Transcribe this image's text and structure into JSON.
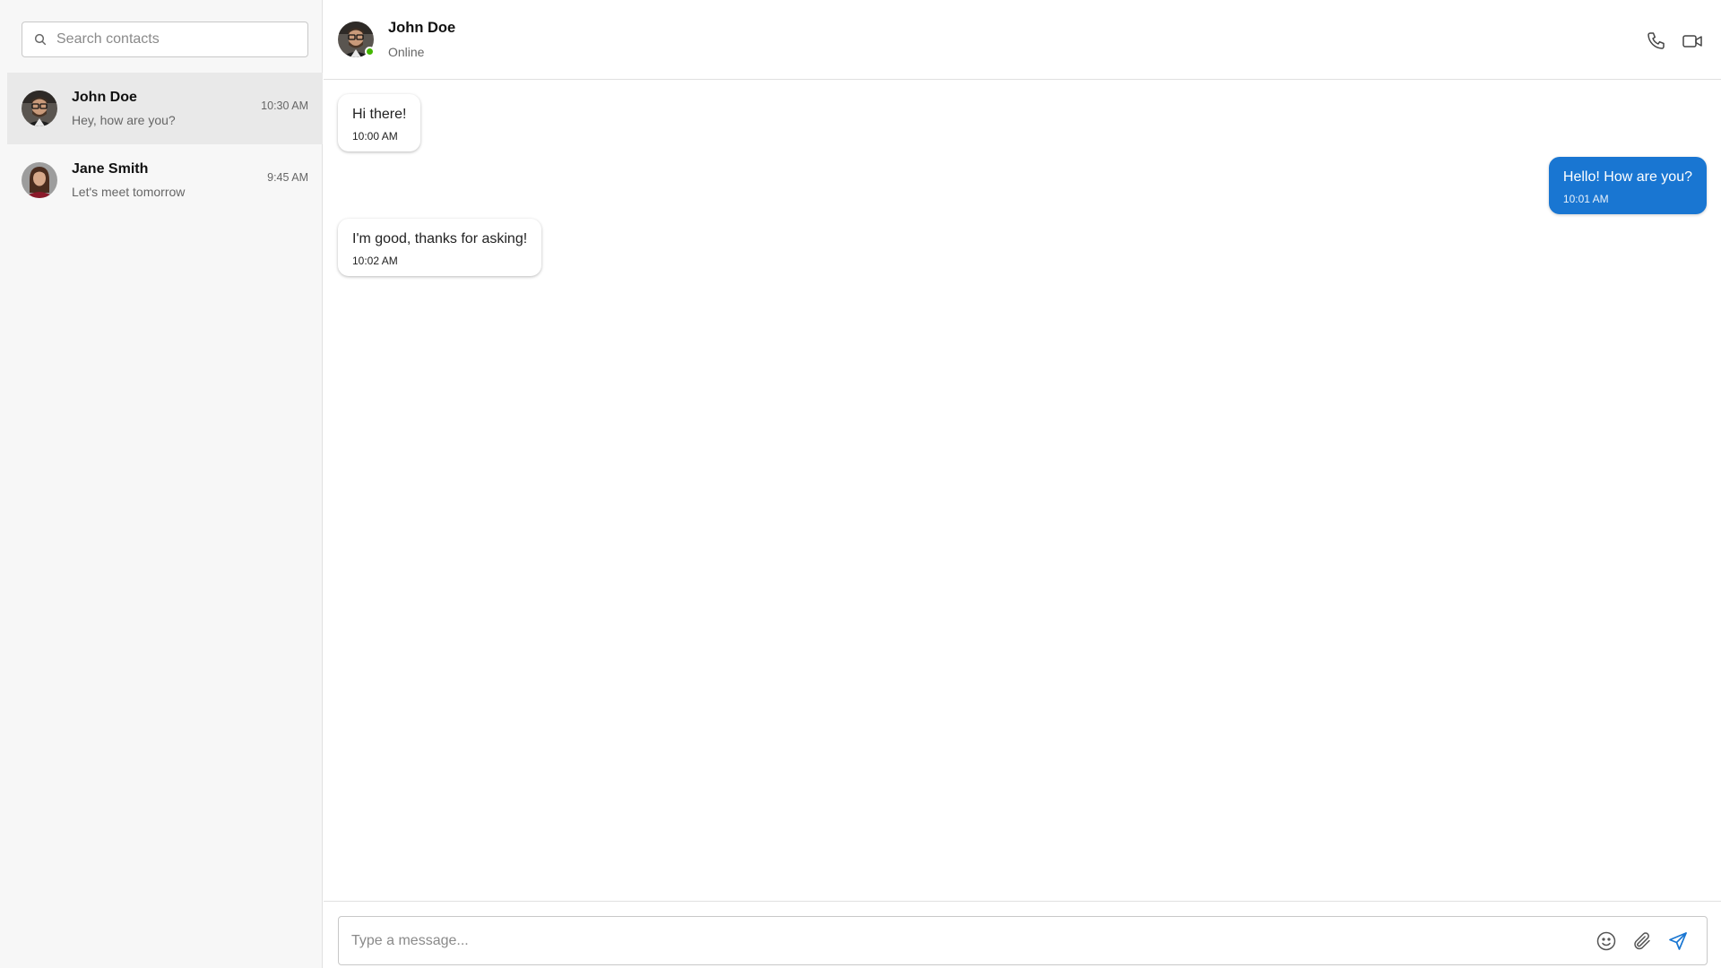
{
  "search": {
    "placeholder": "Search contacts"
  },
  "contacts": [
    {
      "name": "John Doe",
      "preview": "Hey, how are you?",
      "time": "10:30 AM",
      "active": true,
      "avatar": "avatar-john"
    },
    {
      "name": "Jane Smith",
      "preview": "Let's meet tomorrow",
      "time": "9:45 AM",
      "active": false,
      "avatar": "avatar-jane"
    }
  ],
  "header": {
    "name": "John Doe",
    "status": "Online",
    "call_icon": "phone-icon",
    "video_icon": "video-camera-icon"
  },
  "messages": [
    {
      "text": "Hi there!",
      "time": "10:00 AM",
      "direction": "incoming"
    },
    {
      "text": "Hello! How are you?",
      "time": "10:01 AM",
      "direction": "outgoing"
    },
    {
      "text": "I'm good, thanks for asking!",
      "time": "10:02 AM",
      "direction": "incoming"
    }
  ],
  "composer": {
    "placeholder": "Type a message...",
    "emoji_icon": "emoji-icon",
    "attach_icon": "paperclip-icon",
    "send_icon": "send-icon"
  },
  "colors": {
    "accent": "#1976d2",
    "online": "#44b700",
    "sidebar_bg": "#f7f7f7",
    "active_row": "#e9e9e9"
  }
}
